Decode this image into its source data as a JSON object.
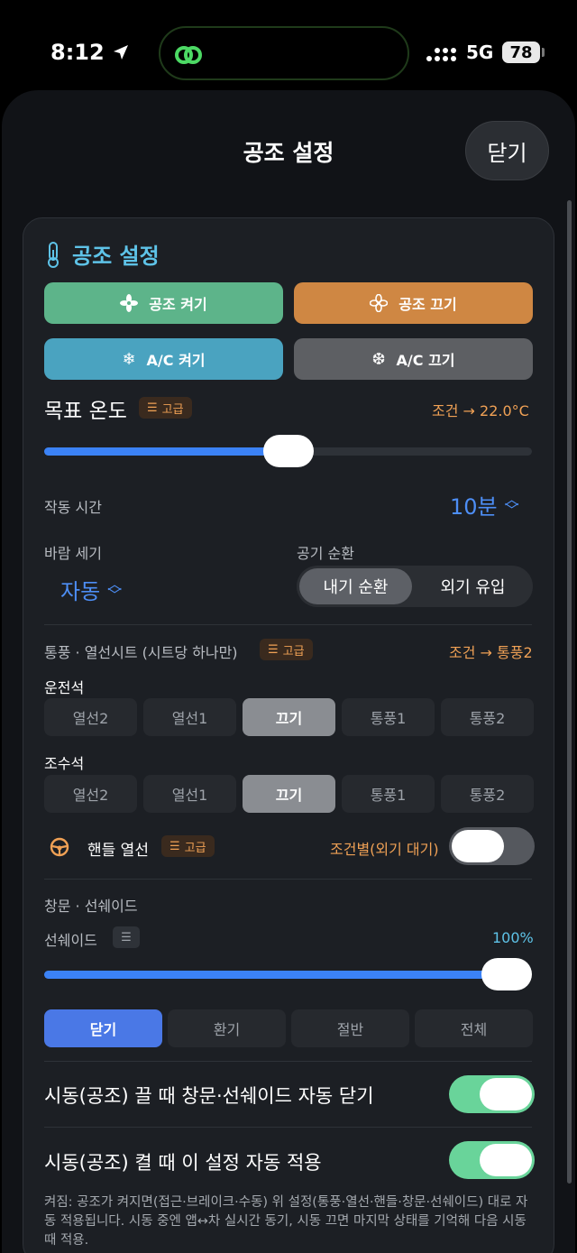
{
  "status": {
    "time": "8:12",
    "network": "5G",
    "battery": "78"
  },
  "sheet": {
    "title": "공조 설정",
    "close_label": "닫기"
  },
  "climate": {
    "section_title": "공조 설정",
    "buttons": {
      "hvac_on": "공조 켜기",
      "hvac_off": "공조 끄기",
      "ac_on": "A/C 켜기",
      "ac_off": "A/C 끄기"
    },
    "target_temp": {
      "label": "목표 온도",
      "badge": "고급",
      "condition": "조건 → 22.0°C",
      "slider_fraction": 0.5
    },
    "run_time": {
      "label": "작동 시간",
      "value": "10분"
    },
    "fan": {
      "label": "바람 세기",
      "value": "자동"
    },
    "air_circ": {
      "label": "공기 순환",
      "options": [
        "내기 순환",
        "외기 유입"
      ],
      "selected": 0
    }
  },
  "seats": {
    "label": "통풍 · 열선시트 (시트당 하나만)",
    "badge": "고급",
    "condition": "조건 → 통풍2",
    "driver": {
      "label": "운전석",
      "options": [
        "열선2",
        "열선1",
        "끄기",
        "통풍1",
        "통풍2"
      ],
      "selected": 2
    },
    "passenger": {
      "label": "조수석",
      "options": [
        "열선2",
        "열선1",
        "끄기",
        "통풍1",
        "통풍2"
      ],
      "selected": 2
    },
    "wheel": {
      "label": "핸들 열선",
      "badge": "고급",
      "condition": "조건별(외기 대기)"
    }
  },
  "windows": {
    "label": "창문 · 선쉐이드",
    "sunshade": {
      "label": "선쉐이드",
      "value": "100%",
      "fraction": 1.0
    },
    "options": [
      "닫기",
      "환기",
      "절반",
      "전체"
    ],
    "selected": 0
  },
  "auto": {
    "close_on_off": "시동(공조) 끌 때 창문·선쉐이드 자동 닫기",
    "apply_on_on": "시동(공조) 켤 때 이 설정 자동 적용",
    "footnote": "켜짐: 공조가 켜지면(접근·브레이크·수동) 위 설정(통풍·열선·핸들·창문·선쉐이드) 대로 자동 적용됩니다. 시동 중엔 앱↔차 실시간 동기, 시동 끄면 마지막 상태를 기억해 다음 시동 때 적용."
  },
  "colors": {
    "green": "#5db48a",
    "orange": "#cf8743",
    "teal": "#4aa3c0",
    "gray": "#5d5f63",
    "blue": "#3b82f6",
    "toggle_on": "#69d49a"
  }
}
